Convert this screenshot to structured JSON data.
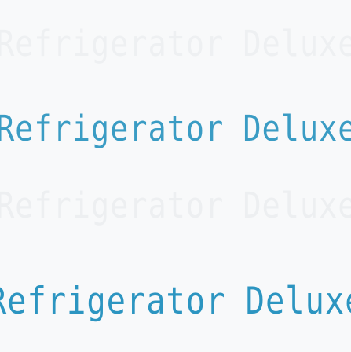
{
  "menu": {
    "options": [
      {
        "label": "Refrigerator Deluxe",
        "state": "ghost"
      },
      {
        "label": "Refrigerator Deluxe",
        "state": "visible"
      },
      {
        "label": "Refrigerator Deluxe",
        "state": "ghost"
      },
      {
        "label": "Refrigerator Deluxe",
        "state": "highlighted"
      }
    ]
  },
  "colors": {
    "background": "#f8f9fa",
    "text_accent": "#3a9cc4",
    "text_ghost": "#eef0f2"
  }
}
